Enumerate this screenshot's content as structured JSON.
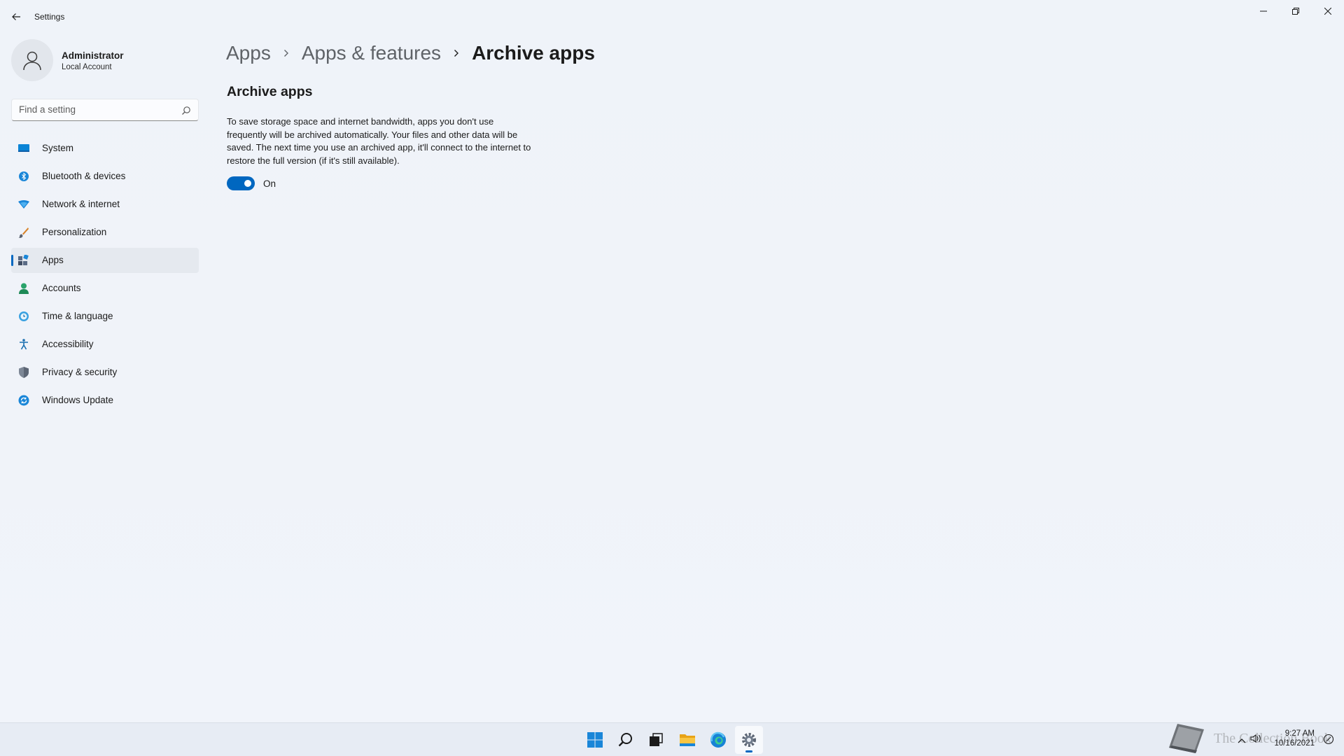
{
  "window": {
    "title": "Settings"
  },
  "user": {
    "name": "Administrator",
    "account_type": "Local Account"
  },
  "search": {
    "placeholder": "Find a setting"
  },
  "sidebar": {
    "items": [
      {
        "label": "System",
        "icon": "system-icon",
        "active": false
      },
      {
        "label": "Bluetooth & devices",
        "icon": "bluetooth-icon",
        "active": false
      },
      {
        "label": "Network & internet",
        "icon": "network-icon",
        "active": false
      },
      {
        "label": "Personalization",
        "icon": "brush-icon",
        "active": false
      },
      {
        "label": "Apps",
        "icon": "apps-icon",
        "active": true
      },
      {
        "label": "Accounts",
        "icon": "accounts-icon",
        "active": false
      },
      {
        "label": "Time & language",
        "icon": "time-language-icon",
        "active": false
      },
      {
        "label": "Accessibility",
        "icon": "accessibility-icon",
        "active": false
      },
      {
        "label": "Privacy & security",
        "icon": "shield-icon",
        "active": false
      },
      {
        "label": "Windows Update",
        "icon": "windows-update-icon",
        "active": false
      }
    ]
  },
  "breadcrumb": {
    "items": [
      "Apps",
      "Apps & features",
      "Archive apps"
    ]
  },
  "main": {
    "section_title": "Archive apps",
    "description": "To save storage space and internet bandwidth, apps you don't use frequently will be archived automatically. Your files and other data will be saved. The next time you use an archived app, it'll connect to the internet to restore the full version (if it's still available).",
    "toggle_state": "On",
    "toggle_on": true
  },
  "taskbar": {
    "apps": [
      "start-icon",
      "search-icon",
      "task-view-icon",
      "file-explorer-icon",
      "edge-icon",
      "settings-icon"
    ],
    "active_app": "settings-icon"
  },
  "watermark": {
    "text": "The Collection Book"
  },
  "clock": {
    "time": "9:27 AM",
    "date": "10/16/2021"
  },
  "colors": {
    "accent": "#0067c0",
    "background": "#eff3f9"
  }
}
